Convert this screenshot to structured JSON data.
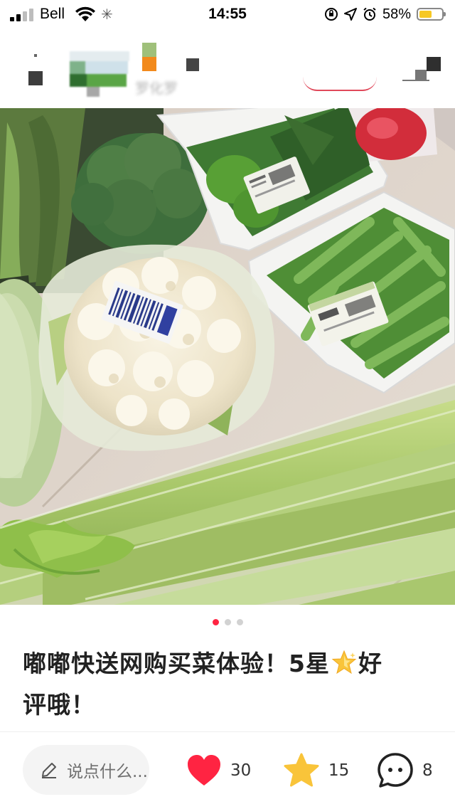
{
  "status_bar": {
    "carrier": "Bell",
    "time": "14:55",
    "battery_percent": "58%",
    "battery_level": 0.58,
    "icons": [
      "signal-icon",
      "wifi-icon",
      "loading-icon",
      "orientation-lock-icon",
      "location-icon",
      "alarm-icon",
      "battery-icon"
    ]
  },
  "header": {
    "author_name_blurred": "罗化罗",
    "icons": [
      "back-icon",
      "share-icon"
    ]
  },
  "gallery": {
    "image_count": 3,
    "active_index": 0
  },
  "post": {
    "title_line1_a": "嘟嘟快送网购买菜体验！5星",
    "title_line1_b": "好",
    "title_line2": "评哦！",
    "title_emoji": "star-emoji"
  },
  "bottom_bar": {
    "comment_placeholder": "说点什么...",
    "like_count": "30",
    "collect_count": "15",
    "comment_count": "8",
    "colors": {
      "like": "#ff2442",
      "collect": "#f9c43a",
      "accent": "#ff2442"
    }
  }
}
